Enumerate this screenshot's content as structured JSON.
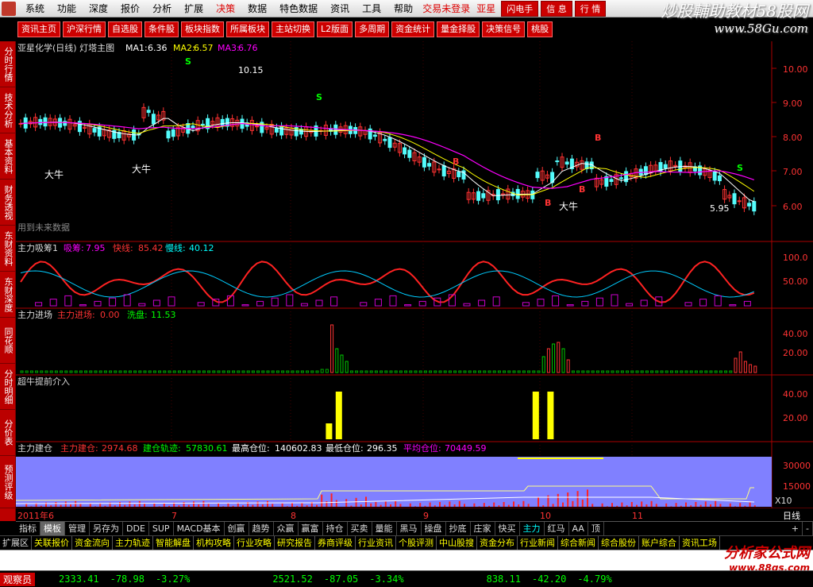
{
  "menu": {
    "items": [
      "系统",
      "功能",
      "深度",
      "报价",
      "分析",
      "扩展",
      "决策",
      "数据",
      "特色数据",
      "资讯",
      "工具",
      "帮助"
    ],
    "highlight": "决策",
    "status": "交易未登录",
    "brand": "亚星",
    "right_buttons": [
      "闪电手",
      "信 息",
      "行 情"
    ]
  },
  "watermark": {
    "text": "炒股輔助教材58股网",
    "url": "www.58Gu.com"
  },
  "toolbar": [
    "资讯主页",
    "沪深行情",
    "自选股",
    "条件股",
    "板块指数",
    "所属板块",
    "主站切换",
    "L2版面",
    "多周期",
    "资金统计",
    "量金择股",
    "决策信号",
    "桃股"
  ],
  "left_nav": [
    "分时行情",
    "技术分析",
    "基本资料",
    "财务透视",
    "东财资料",
    "东财深度",
    "同花顺",
    "分时明细",
    "分价表",
    "预测评级"
  ],
  "main_chart": {
    "title": "亚星化学(日线) 灯塔主图",
    "ma1_label": "MA1:",
    "ma1": "6.36",
    "ma2_label": "MA2:",
    "ma2": "6.57",
    "ma3_label": "MA3:",
    "ma3": "6.76",
    "y_ticks": [
      "10.00",
      "9.00",
      "8.00",
      "7.00",
      "6.00"
    ],
    "annotations": [
      "大牛",
      "大牛",
      "大牛"
    ],
    "high_label": "10.15",
    "low_label": "5.95",
    "note": "用到未来数据",
    "signals": [
      "S",
      "B",
      "B",
      "B",
      "S",
      "S",
      "B"
    ]
  },
  "panel2": {
    "name": "主力吸筹1",
    "k1": "吸筹:",
    "v1": "7.95",
    "k2": "快线:",
    "v2": "85.42",
    "k3": "慢线:",
    "v3": "40.12",
    "y_ticks": [
      "100.0",
      "50.00"
    ]
  },
  "panel3": {
    "name": "主力进场",
    "k1": "主力进场:",
    "v1": "0.00",
    "k2": "洗盘:",
    "v2": "11.53",
    "y_ticks": [
      "40.00",
      "20.00"
    ]
  },
  "panel4": {
    "name": "超牛提前介入",
    "y_ticks": [
      "40.00",
      "20.00"
    ]
  },
  "panel5": {
    "name": "主力建仓",
    "k1": "主力建仓:",
    "v1": "2974.68",
    "k2": "建仓轨迹:",
    "v2": "57830.61",
    "k3": "最高仓位:",
    "v3": "140602.83",
    "k4": "最低仓位:",
    "v4": "296.35",
    "k5": "平均仓位:",
    "v5": "70449.59",
    "y_ticks": [
      "30000",
      "15000"
    ],
    "scale": "X10"
  },
  "x_axis": [
    "2011年6",
    "7",
    "8",
    "9",
    "10",
    "11"
  ],
  "period": "日线",
  "footer_tabs": [
    "指标",
    "模板",
    "管理",
    "另存为",
    "DDE",
    "SUP",
    "MACD基本",
    "创赢",
    "趋势",
    "众赢",
    "赢富",
    "持仓",
    "买卖",
    "量能",
    "黑马",
    "操盘",
    "抄底",
    "庄家",
    "快买",
    "主力",
    "红马",
    "AA",
    "顶"
  ],
  "footer_right": [
    "+",
    "-"
  ],
  "link_tabs": [
    "扩展区",
    "关联报价",
    "资金流向",
    "主力轨迹",
    "智能解盘",
    "机构攻略",
    "行业攻略",
    "研究报告",
    "券商评级",
    "行业资讯",
    "个股评测",
    "中山股搜",
    "资金分布",
    "行业新闻",
    "综合新闻",
    "综合股份",
    "账户综合",
    "资讯工场"
  ],
  "ad": {
    "text": "分析家公式网",
    "url": "www.88gs.com"
  },
  "statusbar": {
    "title": "观察员",
    "i1": "2333.41",
    "i1c": "-78.98",
    "i1p": "-3.27%",
    "i2": "2521.52",
    "i2c": "-87.05",
    "i2p": "-3.34%",
    "i3": "838.11",
    "i3c": "-42.20",
    "i3p": "-4.79%"
  },
  "colors": {
    "up": "#ff3232",
    "down": "#54fcfc",
    "ma1": "#ffffff",
    "ma2": "#ffff00",
    "ma3": "#ff00ff",
    "panel5_bg": "#8080ff"
  }
}
